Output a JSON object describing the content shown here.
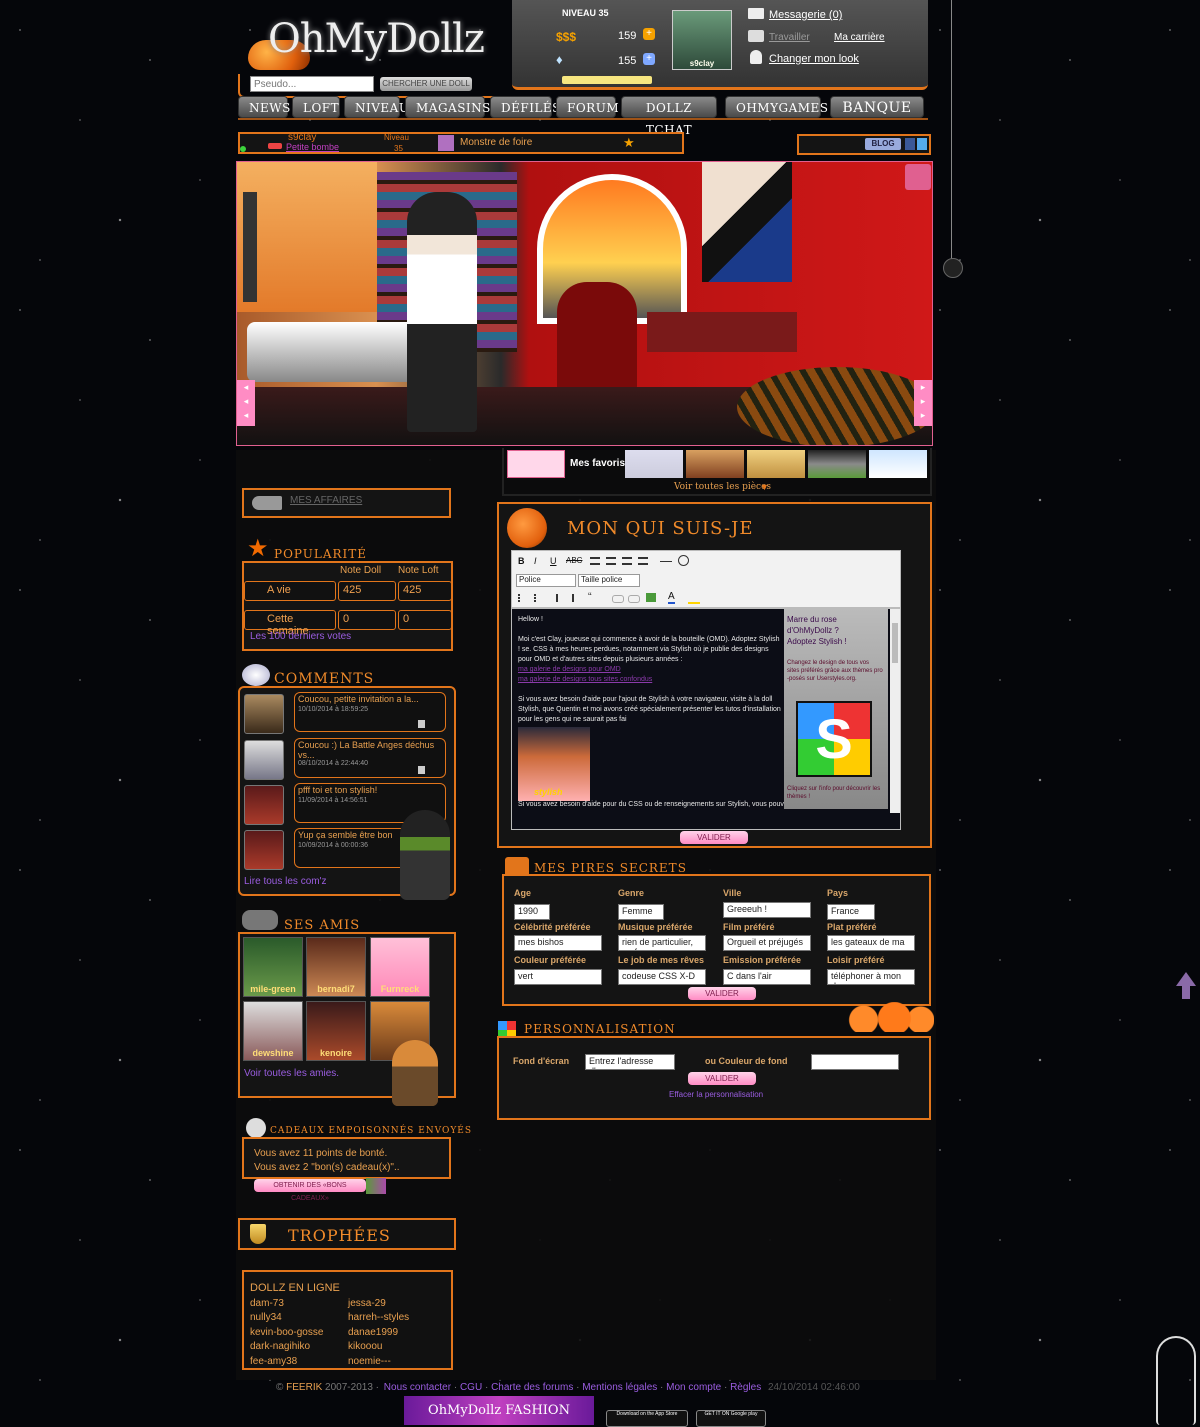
{
  "logo": {
    "text": "OhMyDollz"
  },
  "search": {
    "placeholder": "Pseudo...",
    "button": "CHERCHER UNE DOLL"
  },
  "status": {
    "level_label": "NIVEAU 35",
    "money_label": "$$$",
    "money_value": "159",
    "diamonds_value": "155",
    "doll_name": "s9clay",
    "messages": "Messagerie (0)",
    "work": "Travailler",
    "career": "Ma carrière",
    "change_look": "Changer mon look"
  },
  "nav": {
    "items": [
      "NEWS",
      "LOFT",
      "NIVEAU",
      "MAGASINS",
      "DÉFILÉS",
      "FORUM",
      "DOLLZ TCHAT",
      "OHMYGAMES",
      "BANQUE"
    ]
  },
  "profile_bar": {
    "username": "s9clay",
    "title": "Petite bombe",
    "level_label": "Niveau",
    "level_value": "35",
    "quest": "Monstre de foire",
    "blog": "BLOG"
  },
  "rooms": {
    "favorites": "Mes favoris",
    "see_all": "Voir toutes les pièces"
  },
  "affairs": {
    "label": "MES AFFAIRES"
  },
  "popularity": {
    "title": "POPULARITÉ",
    "col_doll": "Note Doll",
    "col_loft": "Note Loft",
    "row1_label": "A vie",
    "row1_doll": "425",
    "row1_loft": "425",
    "row2_label": "Cette semaine",
    "row2_doll": "0",
    "row2_loft": "0",
    "votes_link": "Les 100 derniers votes"
  },
  "comments": {
    "title": "COMMENTS",
    "items": [
      {
        "text": "Coucou, petite invitation a la...",
        "date": "10/10/2014 à 18:59:25"
      },
      {
        "text": "Coucou :) La Battle Anges déchus vs...",
        "date": "08/10/2014 à 22:44:40"
      },
      {
        "text": "pfff toi et ton stylish!",
        "date": "11/09/2014 à 14:56:51"
      },
      {
        "text": "Yup ça semble être bon",
        "date": "10/09/2014 à 00:00:36"
      }
    ],
    "read_all": "Lire tous les com'z"
  },
  "friends": {
    "title": "SES AMIS",
    "names": [
      "mile-green",
      "bernadi7",
      "Furnreck",
      "dewshine",
      "kenoire",
      ""
    ],
    "see_all": "Voir toutes les amies."
  },
  "gifts": {
    "title": "CADEAUX EMPOISONNÉS ENVOYÉS",
    "line1": "Vous avez 11 points de bonté.",
    "line2": "Vous avez 2 \"bon(s) cadeau(x)\"..",
    "button": "OBTENIR DES «BONS CADEAUX»"
  },
  "trophies": {
    "title": "TROPHÉES"
  },
  "online": {
    "title": "DOLLZ EN LIGNE",
    "col1": [
      "dam-73",
      "nully34",
      "kevin-boo-gosse",
      "dark-nagihiko",
      "fee-amy38"
    ],
    "col2": [
      "jessa-29",
      "harreh--styles",
      "danae1999",
      "kikooou",
      "noemie---"
    ]
  },
  "about": {
    "title": "MON QUI SUIS-JE",
    "font_select": "Police",
    "size_select": "Taille police",
    "greeting": "Hellow !",
    "p1": "Moi c'est Clay, joueuse qui commence à avoir de la bouteille (OMD). Adoptez Stylish ! se. CSS à mes heures perdues, notamment via Stylish où je publie des designs pour OMD et d'autres sites depuis plusieurs années :",
    "link1": "ma galerie de designs pour OMD",
    "link2": "ma galerie de designs tous sites confondus",
    "p2": "Si vous avez besoin d'aide pour l'ajout de Stylish à votre navigateur, visite à la doll Stylish, que Quentin et moi avons créé spécialement présenter les tutos d'installation pour les gens qui ne saurait pas fai",
    "p3": "Si vous avez besoin d'aide pour du CSS ou de renseignements sur Stylish, vous pouvez",
    "ad_line1": "Marre du rose",
    "ad_line2": "d'OhMyDollz ?",
    "ad_line3": "Adoptez Stylish !",
    "ad_line4": "Changez le design de tous vos sites préférés grâce aux thèmes pro -posés sur Userstyles.org.",
    "ad_line5": "Cliquez sur l'info pour découvrir les thèmes !",
    "stylish_label": "stylish",
    "validate": "VALIDER"
  },
  "secrets": {
    "title": "MES PIRES SECRETS",
    "age_label": "Age",
    "age_value": "1990",
    "genre_label": "Genre",
    "genre_value": "Femme",
    "ville_label": "Ville",
    "ville_value": "Greeeuh !",
    "pays_label": "Pays",
    "pays_value": "France",
    "celeb_label": "Célébrité préférée",
    "celeb_value": "mes bishos",
    "music_label": "Musique préférée",
    "music_value": "rien de particulier, au f",
    "film_label": "Film préféré",
    "film_value": "Orgueil et préjugés",
    "plat_label": "Plat préféré",
    "plat_value": "les gateaux de ma mo",
    "color_label": "Couleur préférée",
    "color_value": "vert",
    "job_label": "Le job de mes rêves",
    "job_value": "codeuse CSS X-D",
    "emission_label": "Emission préférée",
    "emission_value": "C dans l'air",
    "loisir_label": "Loisir préféré",
    "loisir_value": "téléphoner à mon den",
    "validate": "VALIDER"
  },
  "personalize": {
    "title": "PERSONNALISATION",
    "bg_label": "Fond d'écran",
    "bg_value": "Entrez l'adresse d'une",
    "or_color": "ou Couleur de fond",
    "validate": "VALIDER",
    "clear": "Effacer la personnalisation"
  },
  "footer": {
    "copyright": "© ",
    "company": "FEERIK",
    "years": " 2007-2013 ·",
    "links": [
      "Nous contacter",
      "CGU",
      "Charte des forums",
      "Mentions légales",
      "Mon compte",
      "Règles"
    ],
    "datetime": "24/10/2014 02:46:00",
    "banner": "OhMyDollz FASHION SHOW",
    "app_store": "Download on the App Store",
    "google_play": "GET IT ON Google play"
  }
}
